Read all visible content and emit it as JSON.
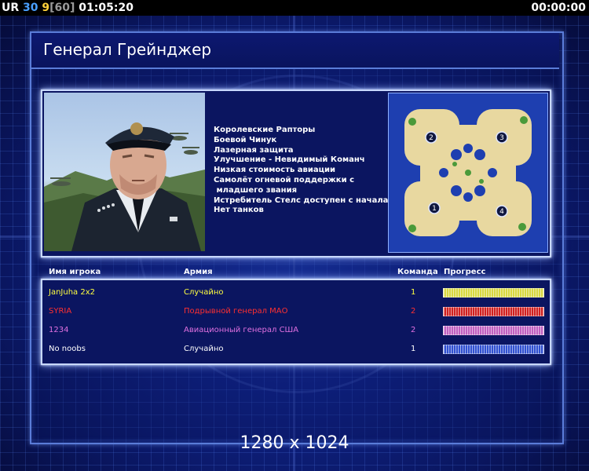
{
  "hud": {
    "prefix": "UR",
    "players": "30",
    "current": "9",
    "limit": "[60]",
    "elapsed": "01:05:20",
    "timer": "00:00:00"
  },
  "general": {
    "title": "Генерал Грейнджер",
    "perks": [
      "Королевские Рапторы",
      "Боевой Чинук",
      "Лазерная защита",
      "Улучшение - Невидимый Команч",
      "Низкая стоимость авиации",
      "Самолёт огневой поддержки с",
      " младшего звания",
      "Истребитель Стелс доступен с начала",
      "Нет танков"
    ]
  },
  "minimap": {
    "start_positions": [
      "2",
      "3",
      "1",
      "4"
    ]
  },
  "table": {
    "headers": {
      "player": "Имя игрока",
      "army": "Армия",
      "team": "Команда",
      "progress": "Прогресс"
    },
    "rows": [
      {
        "name": "JanJuha 2x2",
        "army": "Случайно",
        "team": "1",
        "color": "#ffff40",
        "bar_color": "#d8d840",
        "progress": 1.0
      },
      {
        "name": "SYRIA",
        "army": "Подрывной генерал МАО",
        "team": "2",
        "color": "#ff3030",
        "bar_color": "#d02020",
        "progress": 1.0
      },
      {
        "name": "1234",
        "army": "Авиационный генерал США",
        "team": "2",
        "color": "#e070e0",
        "bar_color": "#c060c0",
        "progress": 1.0
      },
      {
        "name": "No noobs",
        "army": "Случайно",
        "team": "1",
        "color": "#ffffff",
        "bar_color": "#3050d0",
        "progress": 1.0
      }
    ]
  },
  "resolution": "1280 x 1024"
}
